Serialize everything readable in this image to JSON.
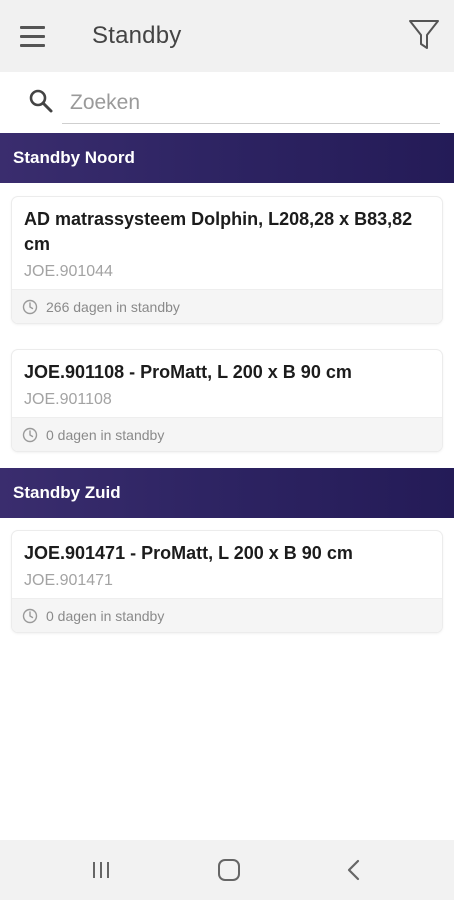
{
  "appbar": {
    "title": "Standby"
  },
  "search": {
    "placeholder": "Zoeken"
  },
  "sections": [
    {
      "header": "Standby Noord",
      "items": [
        {
          "title": "AD matrassysteem Dolphin, L208,28 x B83,82 cm",
          "code": "JOE.901044",
          "days": "266 dagen in standby"
        },
        {
          "title": "JOE.901108 - ProMatt, L 200 x B 90 cm",
          "code": "JOE.901108",
          "days": "0 dagen in standby"
        }
      ]
    },
    {
      "header": "Standby Zuid",
      "items": [
        {
          "title": "JOE.901471 - ProMatt, L 200 x B 90 cm",
          "code": "JOE.901471",
          "days": "0 dagen in standby"
        }
      ]
    }
  ],
  "colors": {
    "header_gradient_start": "#3a2d6e",
    "header_gradient_end": "#241b57",
    "appbar_bg": "#f1f1f1"
  },
  "icons": [
    "menu-icon",
    "filter-icon",
    "search-icon",
    "clock-icon",
    "recent-apps-icon",
    "home-icon",
    "back-icon"
  ]
}
